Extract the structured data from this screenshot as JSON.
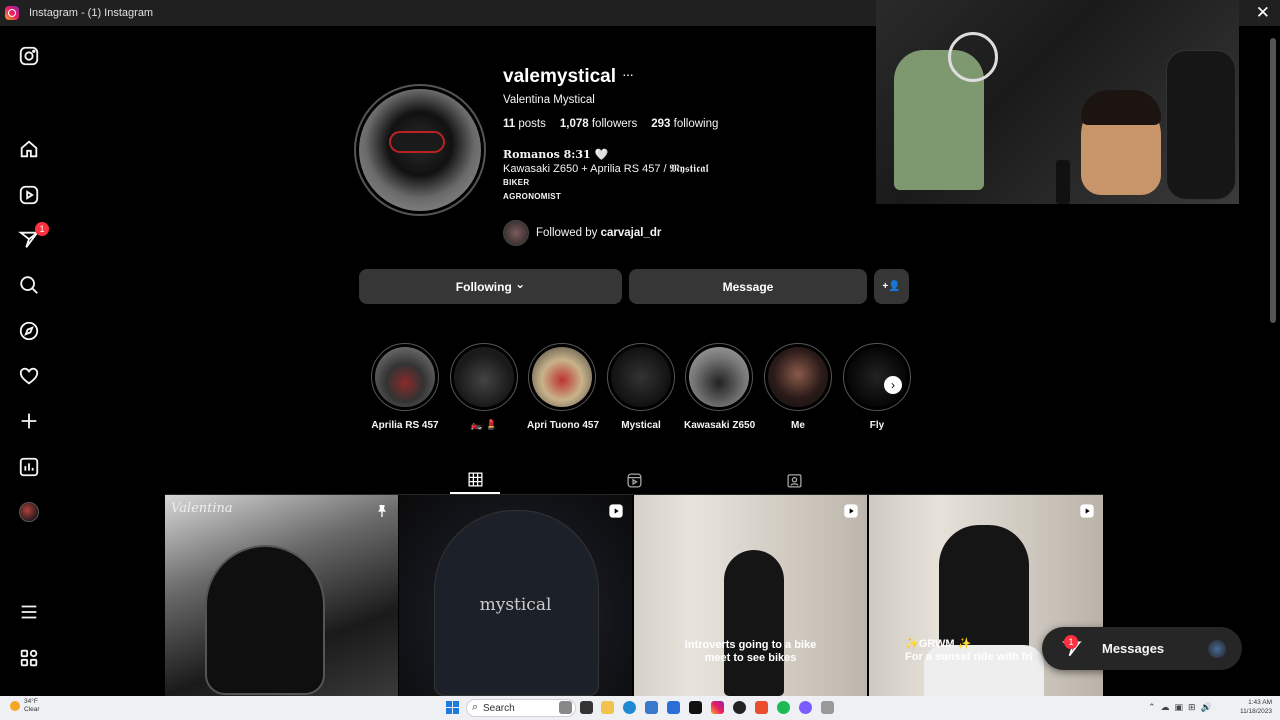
{
  "window": {
    "title": "Instagram - (1) Instagram",
    "close_glyph": "✕"
  },
  "nav": {
    "items": [
      {
        "name": "instagram-logo-icon"
      },
      {
        "name": "home-icon"
      },
      {
        "name": "reels-icon"
      },
      {
        "name": "messages-icon",
        "badge": "1"
      },
      {
        "name": "search-icon"
      },
      {
        "name": "explore-icon"
      },
      {
        "name": "notifications-heart-icon"
      },
      {
        "name": "create-plus-icon"
      },
      {
        "name": "dashboard-icon"
      },
      {
        "name": "profile-avatar"
      },
      {
        "name": "menu-icon"
      },
      {
        "name": "also-from-meta-icon"
      }
    ]
  },
  "profile": {
    "username": "valemystical",
    "more": "···",
    "full_name": "Valentina Mystical",
    "posts_count": "11",
    "posts_label": "posts",
    "followers_count": "1,078",
    "followers_label": "followers",
    "following_count": "293",
    "following_label": "following",
    "bio_line1": "𝐑𝐨𝐦𝐚𝐧𝐨𝐬 𝟖:𝟑𝟏 🤍",
    "bio_line2": "Kawasaki Z650 + Aprilia RS 457 / 𝕸𝖞𝖘𝖙𝖎𝖈𝖆𝖑",
    "bio_line3": "BIKER",
    "bio_line4": "AGRONOMIST",
    "followed_by_prefix": "Followed by",
    "followed_by_user": "carvajal_dr"
  },
  "actions": {
    "following_label": "Following",
    "following_chevron": "⌄",
    "message_label": "Message",
    "add_user_glyph": "+👤"
  },
  "highlights": [
    {
      "label": "Aprilia RS 457"
    },
    {
      "label": "🏍️ 💄"
    },
    {
      "label": "Apri Tuono 457"
    },
    {
      "label": "Mystical"
    },
    {
      "label": "Kawasaki Z650"
    },
    {
      "label": "Me"
    },
    {
      "label": "Fly"
    }
  ],
  "highlights_next": "›",
  "tabs": [
    {
      "name": "tab-posts",
      "icon": "grid-icon",
      "active": true
    },
    {
      "name": "tab-reels",
      "icon": "reels-icon",
      "active": false
    },
    {
      "name": "tab-tagged",
      "icon": "tagged-icon",
      "active": false
    }
  ],
  "posts": [
    {
      "overlay": "pin-icon",
      "watermark": "Valentina",
      "caption": ""
    },
    {
      "overlay": "reel-icon",
      "watermark": "mystical",
      "caption": ""
    },
    {
      "overlay": "reel-icon",
      "caption": "Introverts going to a bike meet to see bikes"
    },
    {
      "overlay": "reel-icon",
      "caption": "✨GRWM ✨\nFor a sunset ride with fri"
    }
  ],
  "messages_widget": {
    "label": "Messages",
    "badge": "1"
  },
  "taskbar": {
    "weather_temp": "34°F",
    "weather_desc": "Clear",
    "search_label": "Search",
    "time": "1:43 AM",
    "date": "11/18/2023"
  }
}
